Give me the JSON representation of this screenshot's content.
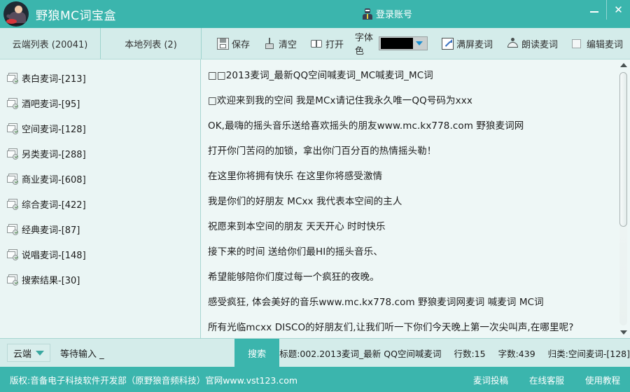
{
  "window": {
    "app_title": "野狼MC词宝盒",
    "login_label": "登录账号",
    "minimize_label": "—",
    "close_label": "✕"
  },
  "tabs": [
    {
      "label": "云端列表 (20041)",
      "name": "tab-cloud-list"
    },
    {
      "label": "本地列表 (2)",
      "name": "tab-local-list"
    }
  ],
  "toolbar": {
    "save_label": "保存",
    "clear_label": "清空",
    "open_label": "打开",
    "font_color_label": "字体色",
    "font_color_value": "#000000",
    "fullscreen_label": "满屏麦词",
    "read_label": "朗读麦词",
    "edit_label": "编辑麦词",
    "edit_checked": false
  },
  "sidebar": {
    "items": [
      {
        "label": "表白麦词-[213]"
      },
      {
        "label": "酒吧麦词-[95]"
      },
      {
        "label": "空间麦词-[128]"
      },
      {
        "label": "另类麦词-[288]"
      },
      {
        "label": "商业麦词-[608]"
      },
      {
        "label": "综合麦词-[422]"
      },
      {
        "label": "经典麦词-[87]"
      },
      {
        "label": "说唱麦词-[148]"
      },
      {
        "label": "搜索结果-[30]"
      }
    ]
  },
  "content": {
    "lines": [
      "□□2013麦词_最新QQ空间喊麦词_MC喊麦词_MC词",
      "□欢迎来到我的空间 我是MCx请记住我永久唯一QQ号码为xxx",
      "OK,最嗨的摇头音乐送给喜欢摇头的朋友www.mc.kx778.com 野狼麦词网",
      "打开你门苦闷的加锁，拿出你门百分百的热情摇头勒！",
      "在这里你将拥有快乐 在这里你将感受激情",
      "我是你们的好朋友 MCxx 我代表本空间的主人",
      "祝愿来到本空间的朋友 天天开心 时时快乐",
      "接下来的时间 送给你们最HI的摇头音乐、",
      "希望能够陪你们度过每一个疯狂的夜晚。",
      "感受疯狂, 体会美好的音乐www.mc.kx778.com 野狼麦词网麦词 喊麦词 MC词",
      "所有光临mcxx DISCO的好朋友们,让我们听一下你们今天晚上第一次尖叫声,在哪里呢?"
    ],
    "scroll_thumb_percent": 61
  },
  "statusbar": {
    "source_label": "云端",
    "search_value": "等待输入 _",
    "search_placeholder": "等待输入",
    "search_button": "搜索",
    "title_info": "标题:002.2013麦词_最新 QQ空间喊麦词",
    "lines_info": "行数:15",
    "words_info": "字数:439",
    "category_info": "归类:空间麦词-[128]"
  },
  "footer": {
    "copyright": "版权:音备电子科技软件开发部（原野狼音频科技）官网www.vst123.com",
    "links": [
      {
        "label": "麦词投稿"
      },
      {
        "label": "在线客服"
      },
      {
        "label": "使用教程"
      }
    ]
  },
  "colors": {
    "brand": "#3bb5ad",
    "toolbar_bg": "#d4ecea",
    "content_bg": "#eef7f6"
  }
}
